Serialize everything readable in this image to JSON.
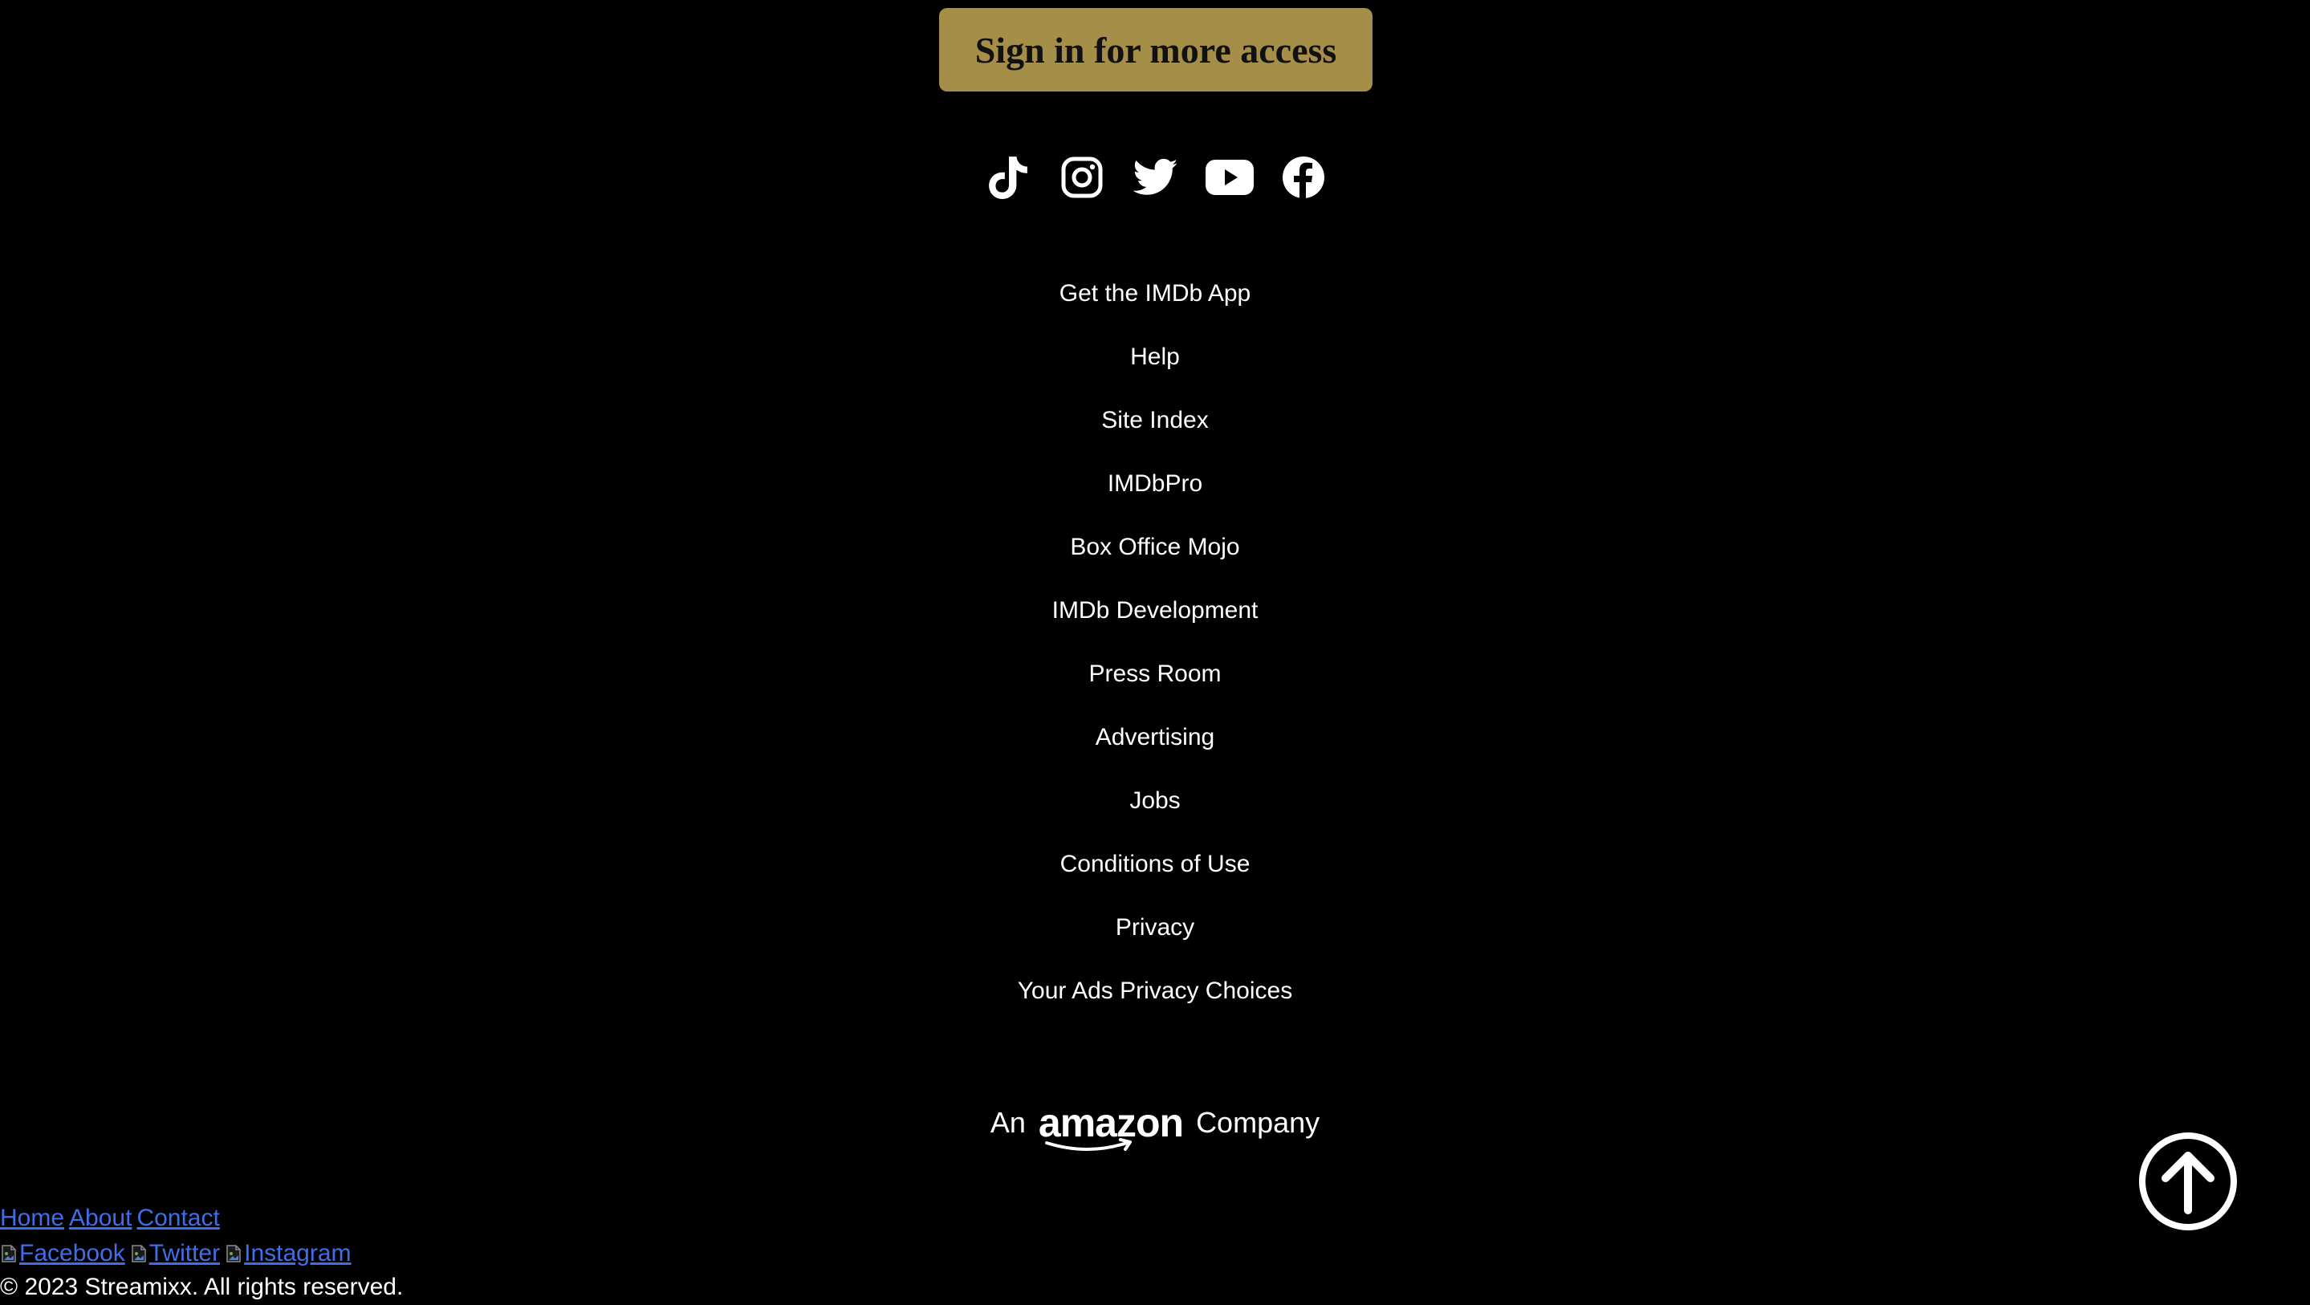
{
  "signin": {
    "label": "Sign in for more access",
    "bg_color": "#a58e47"
  },
  "socials": [
    {
      "name": "tiktok-icon"
    },
    {
      "name": "instagram-icon"
    },
    {
      "name": "twitter-icon"
    },
    {
      "name": "youtube-icon"
    },
    {
      "name": "facebook-icon"
    }
  ],
  "links": [
    "Get the IMDb App",
    "Help",
    "Site Index",
    "IMDbPro",
    "Box Office Mojo",
    "IMDb Development",
    "Press Room",
    "Advertising",
    "Jobs",
    "Conditions of Use",
    "Privacy",
    "Your Ads Privacy Choices"
  ],
  "amazon": {
    "prefix": "An",
    "logo": "amazon",
    "suffix": "Company"
  },
  "back_to_top": {
    "icon": "arrow-up-circle-icon"
  },
  "site_footer": {
    "nav": [
      "Home",
      "About",
      "Contact"
    ],
    "social_alts": [
      "Facebook",
      "Twitter",
      "Instagram"
    ],
    "copyright": "© 2023 Streamixx. All rights reserved.",
    "link_color": "#3f6ee8"
  }
}
